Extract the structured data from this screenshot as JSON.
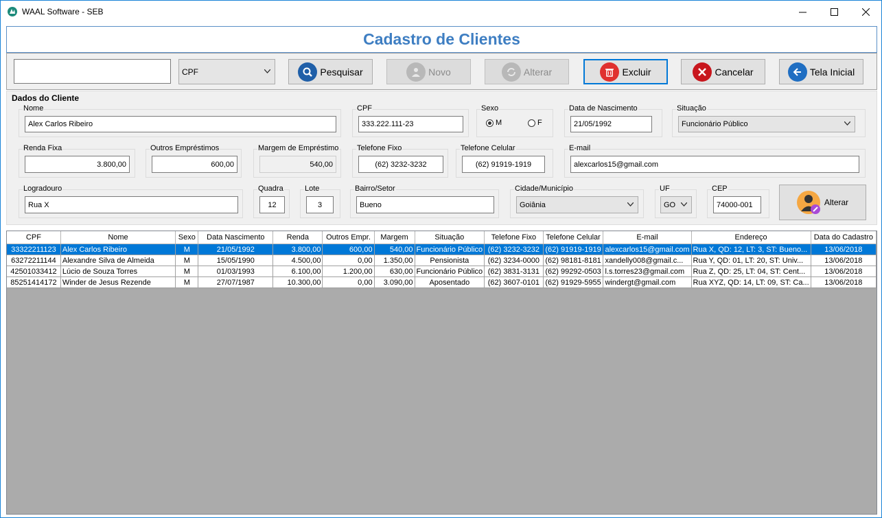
{
  "window": {
    "title": "WAAL Software - SEB"
  },
  "header": {
    "title": "Cadastro de Clientes"
  },
  "toolbar": {
    "search_value": "",
    "search_type": "CPF",
    "pesquisar": "Pesquisar",
    "novo": "Novo",
    "alterar": "Alterar",
    "excluir": "Excluir",
    "cancelar": "Cancelar",
    "tela_inicial": "Tela Inicial"
  },
  "form": {
    "group_title": "Dados do Cliente",
    "nome": {
      "label": "Nome",
      "value": "Alex Carlos Ribeiro"
    },
    "cpf": {
      "label": "CPF",
      "value": "333.222.111-23"
    },
    "sexo": {
      "label": "Sexo",
      "m": "M",
      "f": "F",
      "selected": "M"
    },
    "nascimento": {
      "label": "Data de Nascimento",
      "value": "21/05/1992"
    },
    "situacao": {
      "label": "Situação",
      "value": "Funcionário Público"
    },
    "renda": {
      "label": "Renda Fixa",
      "value": "3.800,00"
    },
    "outros": {
      "label": "Outros Empréstimos",
      "value": "600,00"
    },
    "margem": {
      "label": "Margem de Empréstimo",
      "value": "540,00"
    },
    "tel_fixo": {
      "label": "Telefone Fixo",
      "value": "(62) 3232-3232"
    },
    "tel_cel": {
      "label": "Telefone Celular",
      "value": "(62) 91919-1919"
    },
    "email": {
      "label": "E-mail",
      "value": "alexcarlos15@gmail.com"
    },
    "logradouro": {
      "label": "Logradouro",
      "value": "Rua X"
    },
    "quadra": {
      "label": "Quadra",
      "value": "12"
    },
    "lote": {
      "label": "Lote",
      "value": "3"
    },
    "bairro": {
      "label": "Bairro/Setor",
      "value": "Bueno"
    },
    "cidade": {
      "label": "Cidade/Município",
      "value": "Goiânia"
    },
    "uf": {
      "label": "UF",
      "value": "GO"
    },
    "cep": {
      "label": "CEP",
      "value": "74000-001"
    },
    "alterar_btn": "Alterar"
  },
  "table": {
    "headers": [
      "CPF",
      "Nome",
      "Sexo",
      "Data Nascimento",
      "Renda",
      "Outros Empr.",
      "Margem",
      "Situação",
      "Telefone Fixo",
      "Telefone Celular",
      "E-mail",
      "Endereço",
      "Data do Cadastro"
    ],
    "rows": [
      [
        "33322211123",
        "Alex Carlos Ribeiro",
        "M",
        "21/05/1992",
        "3.800,00",
        "600,00",
        "540,00",
        "Funcionário Público",
        "(62) 3232-3232",
        "(62) 91919-1919",
        "alexcarlos15@gmail.com",
        "Rua X, QD: 12, LT: 3, ST: Bueno...",
        "13/06/2018"
      ],
      [
        "63272211144",
        "Alexandre Silva de Almeida",
        "M",
        "15/05/1990",
        "4.500,00",
        "0,00",
        "1.350,00",
        "Pensionista",
        "(62) 3234-0000",
        "(62) 98181-8181",
        "xandelly008@gmail.c...",
        "Rua Y, QD: 01, LT: 20, ST: Univ...",
        "13/06/2018"
      ],
      [
        "42501033412",
        "Lúcio de Souza Torres",
        "M",
        "01/03/1993",
        "6.100,00",
        "1.200,00",
        "630,00",
        "Funcionário Público",
        "(62) 3831-3131",
        "(62) 99292-0503",
        "l.s.torres23@gmail.com",
        "Rua Z, QD: 25, LT: 04, ST: Cent...",
        "13/06/2018"
      ],
      [
        "85251414172",
        "Winder de Jesus Rezende",
        "M",
        "27/07/1987",
        "10.300,00",
        "0,00",
        "3.090,00",
        "Aposentado",
        "(62) 3607-0101",
        "(62) 91929-5955",
        "windergt@gmail.com",
        "Rua XYZ, QD: 14, LT: 09, ST: Ca...",
        "13/06/2018"
      ]
    ],
    "selected_row": 0
  },
  "colors": {
    "accent": "#0078d7",
    "title": "#3e7ec2"
  }
}
